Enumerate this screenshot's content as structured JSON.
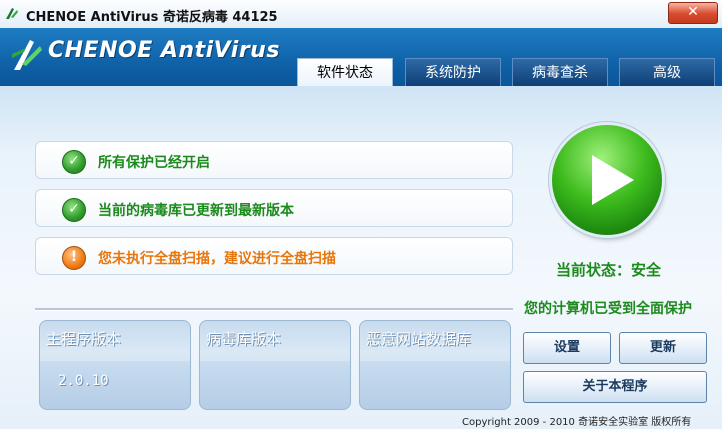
{
  "window": {
    "title": "CHENOE AntiVirus 奇诺反病毒  44125",
    "close_label": "✕"
  },
  "header": {
    "brand": "CHENOE AntiVirus",
    "tabs": [
      {
        "label": "软件状态",
        "active": true
      },
      {
        "label": "系统防护",
        "active": false
      },
      {
        "label": "病毒查杀",
        "active": false
      },
      {
        "label": "高级",
        "active": false
      }
    ]
  },
  "status_items": [
    {
      "text": "所有保护已经开启",
      "type": "ok",
      "icon": "check-icon"
    },
    {
      "text": "当前的病毒库已更新到最新版本",
      "type": "ok",
      "icon": "check-icon"
    },
    {
      "text": "您未执行全盘扫描，建议进行全盘扫描",
      "type": "warn",
      "icon": "exclamation-icon"
    }
  ],
  "panels": [
    {
      "title": "主程序版本",
      "value": "2.0.10"
    },
    {
      "title": "病毒库版本",
      "value": ""
    },
    {
      "title": "恶意网站数据库",
      "value": ""
    }
  ],
  "state": {
    "current_status": "当前状态：安全",
    "protection_message": "您的计算机已受到全面保护"
  },
  "buttons": {
    "settings": "设置",
    "update": "更新",
    "about": "关于本程序"
  },
  "footer": {
    "copyright": "Copyright  2009 - 2010 奇诺安全实验室 版权所有"
  },
  "colors": {
    "header_blue": "#0e5ea4",
    "ok_green": "#1c8a1c",
    "warn_orange": "#e8760a"
  }
}
